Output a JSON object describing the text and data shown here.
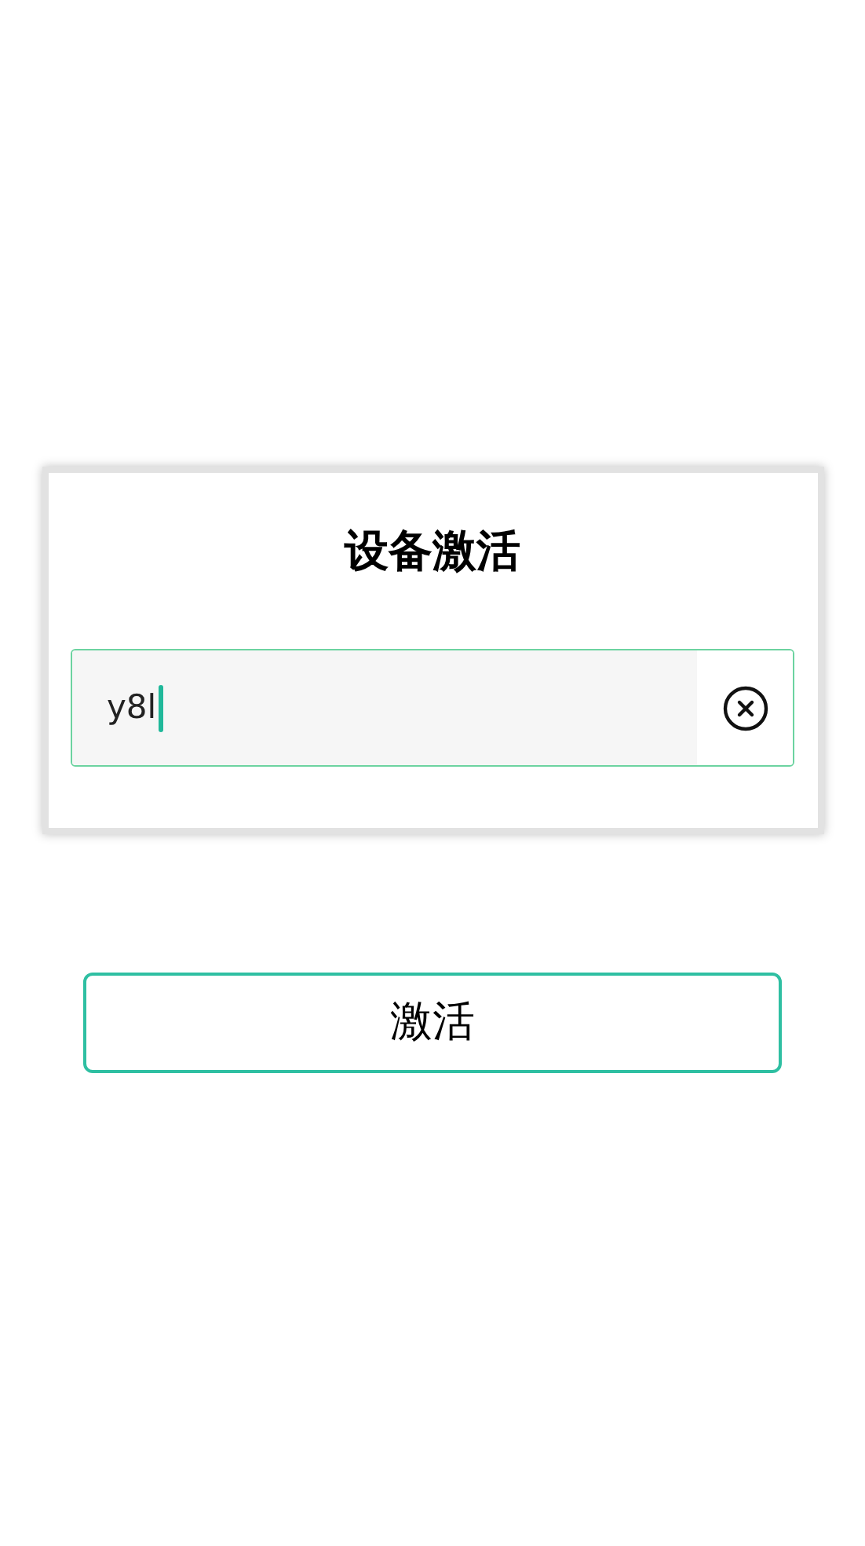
{
  "dialog": {
    "title": "设备激活",
    "field": {
      "value": "y8l",
      "focused": true
    }
  },
  "buttons": [
    "激活"
  ]
}
